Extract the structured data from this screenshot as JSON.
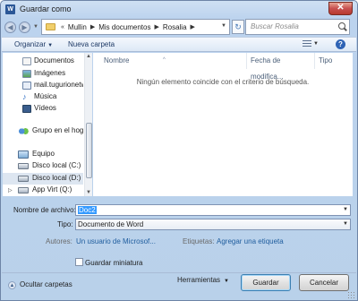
{
  "window": {
    "title": "Guardar como",
    "app_icon": "W"
  },
  "address": {
    "overflow_glyph": "«",
    "crumbs": [
      "Mullin",
      "Mis documentos",
      "Rosalia"
    ],
    "search_placeholder": "Buscar Rosalia"
  },
  "toolbar": {
    "organize": "Organizar",
    "new_folder": "Nueva carpeta"
  },
  "nav": {
    "items": [
      {
        "label": "Documentos",
        "icon": "documents-icon"
      },
      {
        "label": "Imágenes",
        "icon": "pictures-icon"
      },
      {
        "label": "mail.tugurionetw",
        "icon": "mail-folder-icon"
      },
      {
        "label": "Música",
        "icon": "music-icon",
        "glyph": "♪"
      },
      {
        "label": "Vídeos",
        "icon": "videos-icon"
      },
      {
        "label": "Grupo en el hogar",
        "icon": "homegroup-icon"
      },
      {
        "label": "Equipo",
        "icon": "computer-icon"
      },
      {
        "label": "Disco local (C:)",
        "icon": "drive-c-icon"
      },
      {
        "label": "Disco local (D:)",
        "icon": "drive-d-icon",
        "selected": true
      },
      {
        "label": "App Virt (Q:)",
        "icon": "drive-q-icon"
      }
    ]
  },
  "filelist": {
    "columns": [
      "Nombre",
      "Fecha de modifica...",
      "Tipo"
    ],
    "empty_message": "Ningún elemento coincide con el criterio de búsqueda."
  },
  "form": {
    "filename_label": "Nombre de archivo:",
    "filename_value": "Doc2",
    "type_label": "Tipo:",
    "type_value": "Documento de Word",
    "authors_label": "Autores:",
    "authors_value": "Un usuario de Microsof...",
    "tags_label": "Etiquetas:",
    "tags_value": "Agregar una etiqueta",
    "thumbnail_label": "Guardar miniatura",
    "thumbnail_checked": false
  },
  "footer": {
    "hide_folders": "Ocultar carpetas",
    "tools": "Herramientas",
    "save": "Guardar",
    "cancel": "Cancelar"
  }
}
